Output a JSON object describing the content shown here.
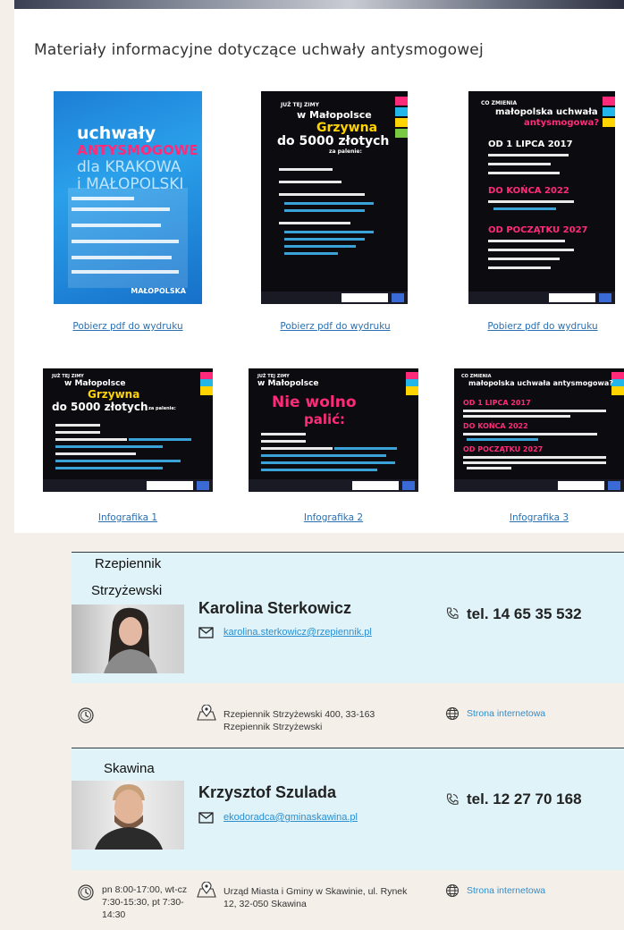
{
  "section_title": "Materiały informacyjne dotyczące uchwały antysmogowej",
  "materials": [
    {
      "link": "Pobierz pdf do wydruku",
      "poster_lines": [
        "uchwały",
        "ANTYSMOGOWE",
        "dla KRAKOWA",
        "i MAŁOPOLSKI"
      ],
      "brand": "MAŁOPOLSKA"
    },
    {
      "link": "Pobierz pdf do wydruku",
      "poster_lines": [
        "JUŻ TEJ ZIMY",
        "w Małopolsce",
        "Grzywna",
        "do 5000 złotych",
        "za palenie:"
      ],
      "brand": "MAŁOPOLSKA"
    },
    {
      "link": "Pobierz pdf do wydruku",
      "poster_lines": [
        "CO ZMIENIA",
        "małopolska uchwała",
        "antysmogowa?",
        "OD 1 LIPCA 2017",
        "DO KOŃCA 2022",
        "OD POCZĄTKU 2027"
      ],
      "brand": "MAŁOPOLSKA"
    },
    {
      "link": "Infografika 1",
      "poster_lines": [
        "JUŻ TEJ ZIMY",
        "w Małopolsce",
        "Grzywna",
        "do 5000 złotych",
        "za palenie:"
      ],
      "brand": "MAŁOPOLSKA"
    },
    {
      "link": "Infografika 2",
      "poster_lines": [
        "JUŻ TEJ ZIMY",
        "w Małopolsce",
        "Nie wolno",
        "palić:"
      ],
      "brand": "MAŁOPOLSKA"
    },
    {
      "link": "Infografika 3",
      "poster_lines": [
        "CO ZMIENIA",
        "małopolska uchwała antysmogowa?",
        "OD 1 LIPCA 2017",
        "DO KOŃCA 2022",
        "OD POCZĄTKU 2027"
      ],
      "brand": "MAŁOPOLSKA"
    }
  ],
  "advisors": [
    {
      "city": [
        "Rzepiennik",
        "Strzyżewski"
      ],
      "name": "Karolina Sterkowicz",
      "email": "karolina.sterkowicz@rzepiennik.pl",
      "phone": "tel. 14 65 35 532",
      "hours": "",
      "address": "Rzepiennik Strzyżewski 400, 33-163 Rzepiennik Strzyżewski",
      "website": "Strona internetowa"
    },
    {
      "city": [
        "Skawina"
      ],
      "name": "Krzysztof Szulada",
      "email": "ekodoradca@gminaskawina.pl",
      "phone": "tel. 12 27 70 168",
      "hours": "pn 8:00-17:00, wt-cz 7:30-15:30, pt 7:30-14:30",
      "address": "Urząd Miasta i Gminy w Skawinie, ul. Rynek 12, 32-050 Skawina",
      "website": "Strona internetowa"
    }
  ],
  "icons": {
    "hours": "clock-icon",
    "address": "map-pin-icon",
    "website": "globe-icon",
    "email": "envelope-icon",
    "phone": "phone-icon"
  },
  "colors": {
    "band": "#dff3f9",
    "link": "#2a6fb0",
    "accent_pink": "#ff2a7a",
    "accent_yellow": "#ffd400"
  }
}
